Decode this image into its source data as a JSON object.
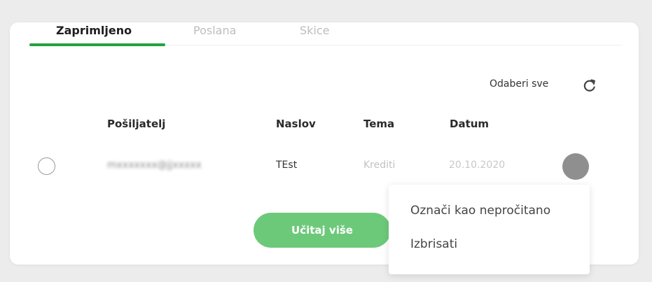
{
  "tabs": [
    {
      "label": "Zaprimljeno",
      "active": true
    },
    {
      "label": "Poslana",
      "active": false
    },
    {
      "label": "Skice",
      "active": false
    }
  ],
  "toolbar": {
    "select_all_label": "Odaberi sve",
    "refresh_icon": "refresh-icon"
  },
  "table": {
    "headers": [
      "Pošiljatelj",
      "Naslov",
      "Tema",
      "Datum"
    ],
    "rows": [
      {
        "sender": "mxxxxxxx@jjxxxxx",
        "subject": "TEst",
        "topic": "Krediti",
        "date": "20.10.2020"
      }
    ]
  },
  "load_more_label": "Učitaj više",
  "context_menu": {
    "items": [
      "Označi kao nepročitano",
      "Izbrisati"
    ]
  },
  "colors": {
    "accent": "#21a33a",
    "button": "#6dc97a",
    "background": "#ececec"
  }
}
